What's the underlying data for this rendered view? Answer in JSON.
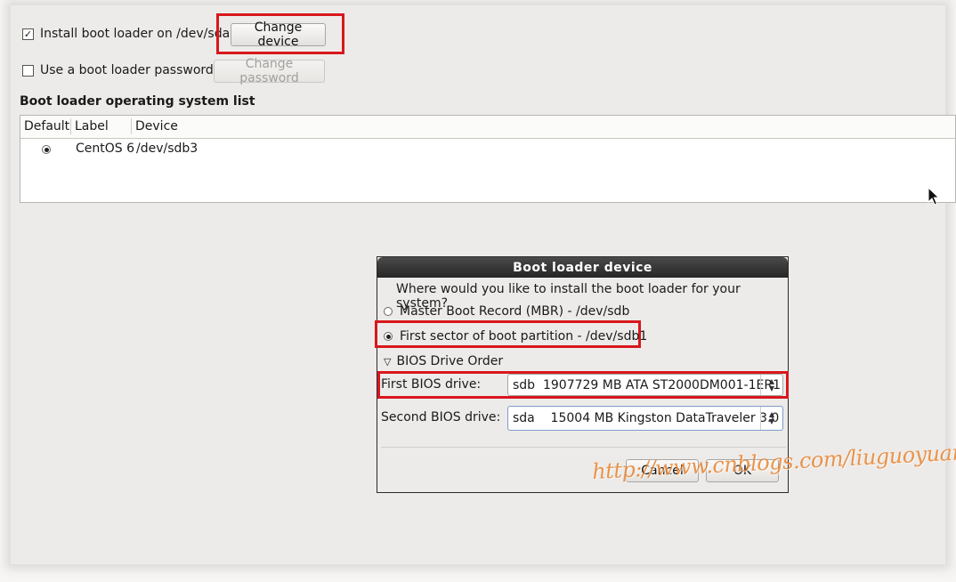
{
  "bootloader": {
    "install_label": "Install boot loader on /dev/sda",
    "install_checked": true,
    "change_device_button": "Change device",
    "password_label": "Use a boot loader password",
    "password_checked": false,
    "change_password_button": "Change password"
  },
  "os_list": {
    "title": "Boot loader operating system list",
    "columns": [
      "Default",
      "Label",
      "Device"
    ],
    "rows": [
      {
        "default": true,
        "label": "CentOS 6",
        "device": "/dev/sdb3"
      }
    ]
  },
  "dialog": {
    "title": "Boot loader device",
    "question": "Where would you like to install the boot loader for your system?",
    "options": [
      {
        "label": "Master Boot Record (MBR) - /dev/sdb",
        "selected": false
      },
      {
        "label": "First sector of boot partition - /dev/sdb1",
        "selected": true
      }
    ],
    "bios_order_label": "BIOS Drive Order",
    "first_bios_label": "First BIOS drive:",
    "first_bios_value": "sdb  1907729 MB ATA ST2000DM001-1ER1",
    "second_bios_label": "Second BIOS drive:",
    "second_bios_value": "sda    15004 MB Kingston DataTraveler 3.0",
    "cancel_button": "Cancel",
    "ok_button": "OK"
  },
  "watermark": "http://www.cnblogs.com/liuguoyuan/",
  "colors": {
    "highlight": "#d8171d",
    "titlebar": "#2b2b2b",
    "watermark": "#e6781e"
  }
}
